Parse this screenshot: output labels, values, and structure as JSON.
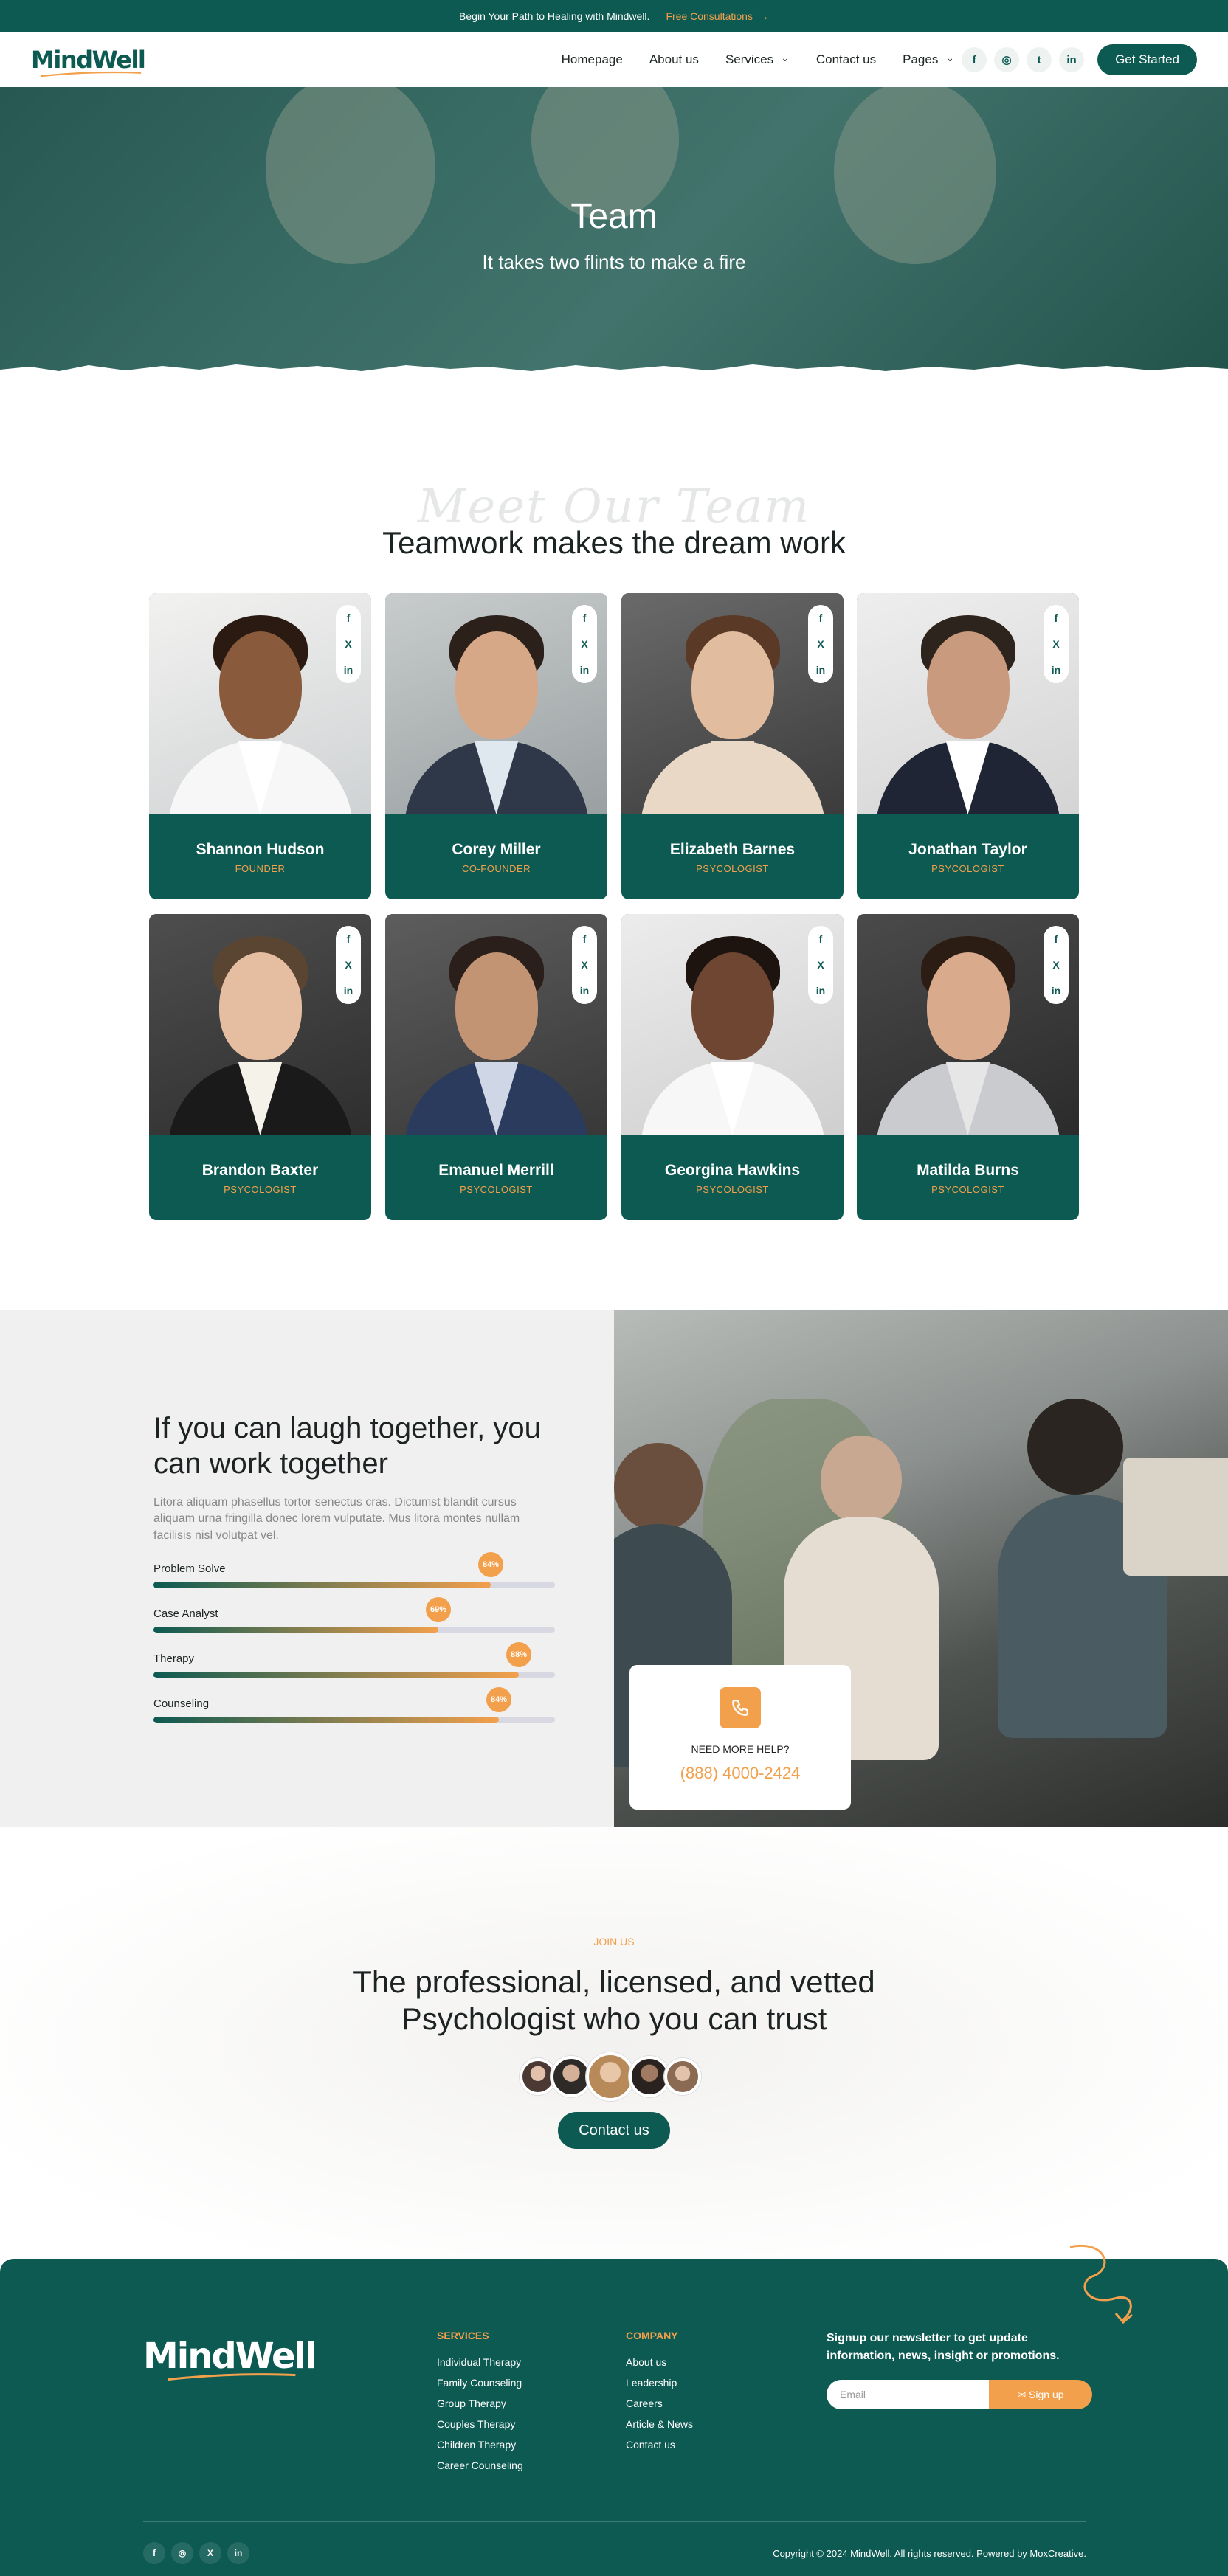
{
  "topbar": {
    "text": "Begin Your Path to Healing with Mindwell.",
    "link": "Free Consultations",
    "arrow": "→"
  },
  "nav": {
    "logo": "MindWell",
    "items": [
      "Homepage",
      "About us",
      "Services",
      "Contact us",
      "Pages"
    ],
    "chevron": "⌄",
    "social": [
      "f",
      "◎",
      "t",
      "in"
    ],
    "cta": "Get Started"
  },
  "hero": {
    "title": "Team",
    "subtitle": "It takes two flints to make a fire"
  },
  "team": {
    "script": "Meet Our Team",
    "title": "Teamwork makes the dream work",
    "social": [
      "f",
      "X",
      "in"
    ],
    "members": [
      {
        "name": "Shannon Hudson",
        "role": "FOUNDER"
      },
      {
        "name": "Corey Miller",
        "role": "CO-FOUNDER"
      },
      {
        "name": "Elizabeth Barnes",
        "role": "PSYCOLOGIST"
      },
      {
        "name": "Jonathan Taylor",
        "role": "PSYCOLOGIST"
      },
      {
        "name": "Brandon Baxter",
        "role": "PSYCOLOGIST"
      },
      {
        "name": "Emanuel Merrill",
        "role": "PSYCOLOGIST"
      },
      {
        "name": "Georgina Hawkins",
        "role": "PSYCOLOGIST"
      },
      {
        "name": "Matilda Burns",
        "role": "PSYCOLOGIST"
      }
    ]
  },
  "skills": {
    "title": "If you can laugh together, you can work together",
    "desc": "Litora aliquam phasellus tortor senectus cras. Dictumst blandit cursus aliquam urna fringilla donec lorem vulputate. Mus litora montes nullam facilisis nisl volutpat vel.",
    "items": [
      {
        "label": "Problem Solve",
        "value": 0.84,
        "badge": "84%"
      },
      {
        "label": "Case Analyst",
        "value": 0.71,
        "badge": "69%"
      },
      {
        "label": "Therapy",
        "value": 0.91,
        "badge": "88%"
      },
      {
        "label": "Counseling",
        "value": 0.86,
        "badge": "84%"
      }
    ]
  },
  "help": {
    "icon": "phone-icon",
    "label": "NEED MORE HELP?",
    "phone": "(888) 4000-2424"
  },
  "join": {
    "kicker": "JOIN US",
    "title_line1": "The professional, licensed, and vetted",
    "title_line2": "Psychologist who you can trust",
    "cta": "Contact us"
  },
  "footer": {
    "logo": "MindWell",
    "services_title": "SERVICES",
    "services": [
      "Individual Therapy",
      "Family Counseling",
      "Group Therapy",
      "Couples Therapy",
      "Children Therapy",
      "Career Counseling"
    ],
    "company_title": "COMPANY",
    "company": [
      "About us",
      "Leadership",
      "Careers",
      "Article & News",
      "Contact us"
    ],
    "newsletter": "Signup our newsletter to get update information, news, insight or promotions.",
    "email_placeholder": "Email",
    "signup": "✉ Sign up",
    "social": [
      "f",
      "◎",
      "X",
      "in"
    ],
    "copyright": "Copyright © 2024 MindWell, All rights reserved. Powered by MoxCreative."
  },
  "colors": {
    "primary": "#0d5a52",
    "accent": "#f3a04c"
  }
}
